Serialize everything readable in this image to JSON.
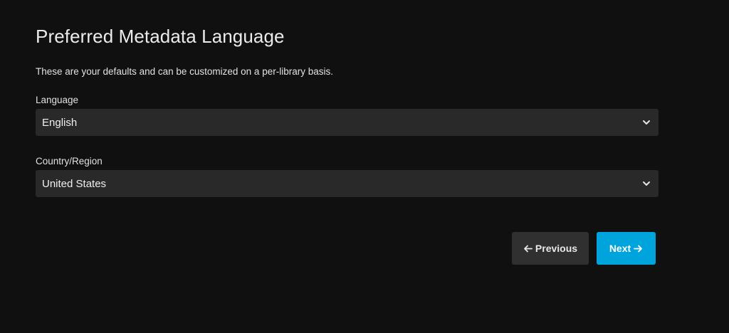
{
  "header": {
    "title": "Preferred Metadata Language",
    "description": "These are your defaults and can be customized on a per-library basis."
  },
  "form": {
    "language": {
      "label": "Language",
      "value": "English",
      "icon": "chevron-down-icon"
    },
    "country": {
      "label": "Country/Region",
      "value": "United States",
      "icon": "chevron-down-icon"
    }
  },
  "actions": {
    "previous_label": "Previous",
    "previous_icon": "arrow-left-icon",
    "next_label": "Next",
    "next_icon": "arrow-right-icon"
  },
  "colors": {
    "background": "#101010",
    "field_background": "#292929",
    "secondary_button": "#303030",
    "accent": "#00a4dc"
  }
}
